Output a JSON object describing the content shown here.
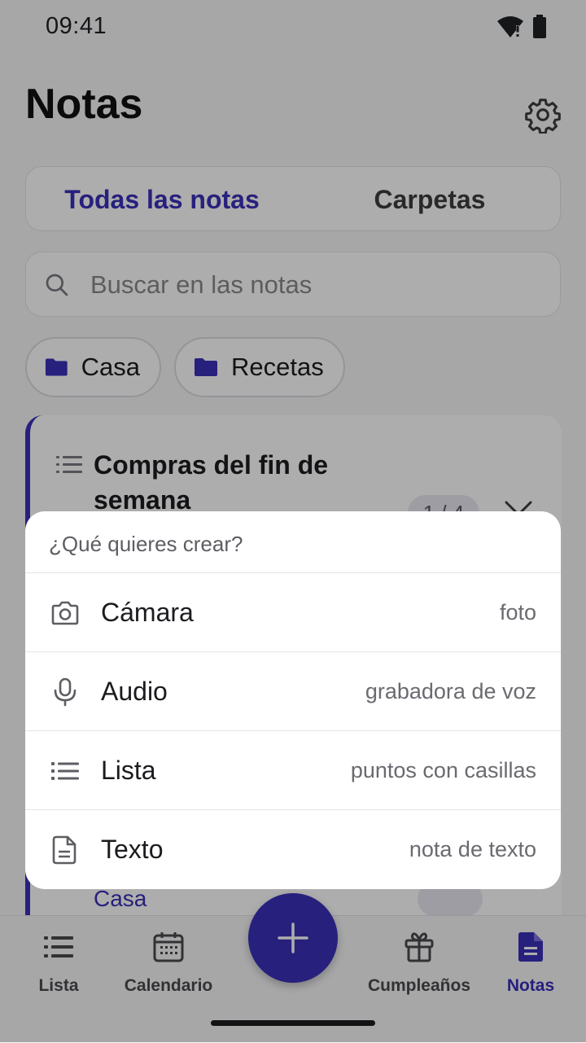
{
  "status_bar": {
    "time": "09:41"
  },
  "header": {
    "title": "Notas"
  },
  "segmented": {
    "all_notes": "Todas las notas",
    "folders": "Carpetas"
  },
  "search": {
    "placeholder": "Buscar en las notas"
  },
  "folder_chips": [
    {
      "label": "Casa"
    },
    {
      "label": "Recetas"
    }
  ],
  "note": {
    "title": "Compras del fin de semana",
    "progress": "1 / 4",
    "folder": "Casa"
  },
  "create_sheet": {
    "title": "¿Qué quieres crear?",
    "options": [
      {
        "label": "Cámara",
        "desc": "foto",
        "icon": "camera-icon"
      },
      {
        "label": "Audio",
        "desc": "grabadora de voz",
        "icon": "microphone-icon"
      },
      {
        "label": "Lista",
        "desc": "puntos con casillas",
        "icon": "list-icon"
      },
      {
        "label": "Texto",
        "desc": "nota de texto",
        "icon": "document-icon"
      }
    ]
  },
  "bottom_nav": {
    "items": [
      {
        "label": "Lista",
        "icon": "list-icon"
      },
      {
        "label": "Calendario",
        "icon": "calendar-icon"
      },
      {
        "label": "Cumpleaños",
        "icon": "gift-icon"
      },
      {
        "label": "Notas",
        "icon": "note-icon",
        "active": true
      }
    ]
  },
  "colors": {
    "accent": "#3a30b8",
    "background": "#f6f6f8",
    "scrim": "rgba(0,0,0,0.32)"
  }
}
